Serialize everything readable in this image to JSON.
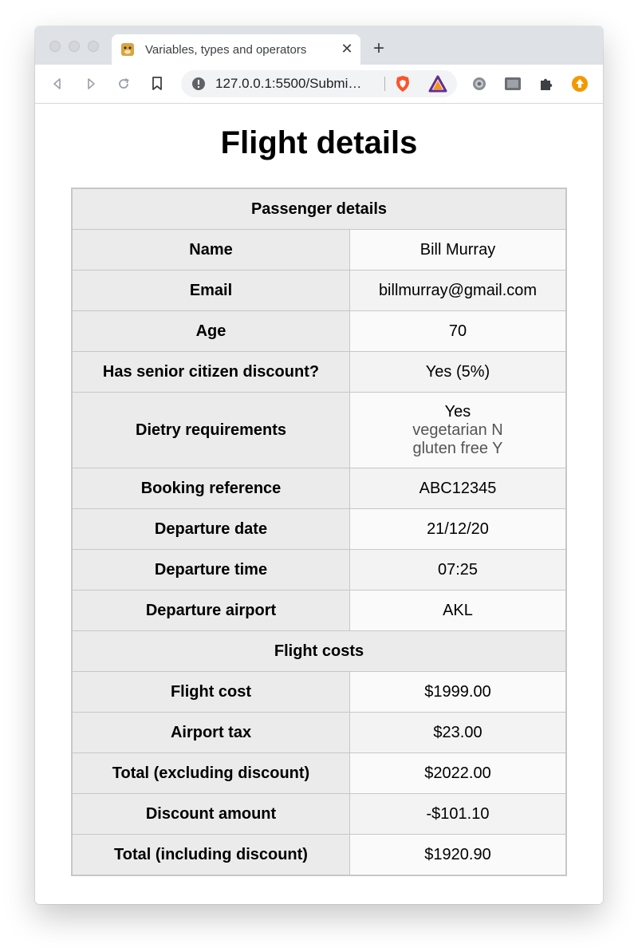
{
  "browser": {
    "tab_title": "Variables, types and operators",
    "url": "127.0.0.1:5500/Submi…",
    "close_label": "✕",
    "newtab_label": "+"
  },
  "page": {
    "title": "Flight details"
  },
  "passenger": {
    "header": "Passenger details",
    "rows": [
      {
        "label": "Name",
        "value": "Bill Murray"
      },
      {
        "label": "Email",
        "value": "billmurray@gmail.com"
      },
      {
        "label": "Age",
        "value": "70"
      },
      {
        "label": "Has senior citizen discount?",
        "value": "Yes (5%)"
      }
    ],
    "dietary": {
      "label": "Dietry requirements",
      "value": "Yes",
      "line1": "vegetarian N",
      "line2": "gluten free Y"
    },
    "rows2": [
      {
        "label": "Booking reference",
        "value": "ABC12345"
      },
      {
        "label": "Departure date",
        "value": "21/12/20"
      },
      {
        "label": "Departure time",
        "value": "07:25"
      },
      {
        "label": "Departure airport",
        "value": "AKL"
      }
    ]
  },
  "costs": {
    "header": "Flight costs",
    "rows": [
      {
        "label": "Flight cost",
        "value": "$1999.00"
      },
      {
        "label": "Airport tax",
        "value": "$23.00"
      },
      {
        "label": "Total (excluding discount)",
        "value": "$2022.00"
      },
      {
        "label": "Discount amount",
        "value": "-$101.10"
      },
      {
        "label": "Total (including discount)",
        "value": "$1920.90"
      }
    ]
  }
}
